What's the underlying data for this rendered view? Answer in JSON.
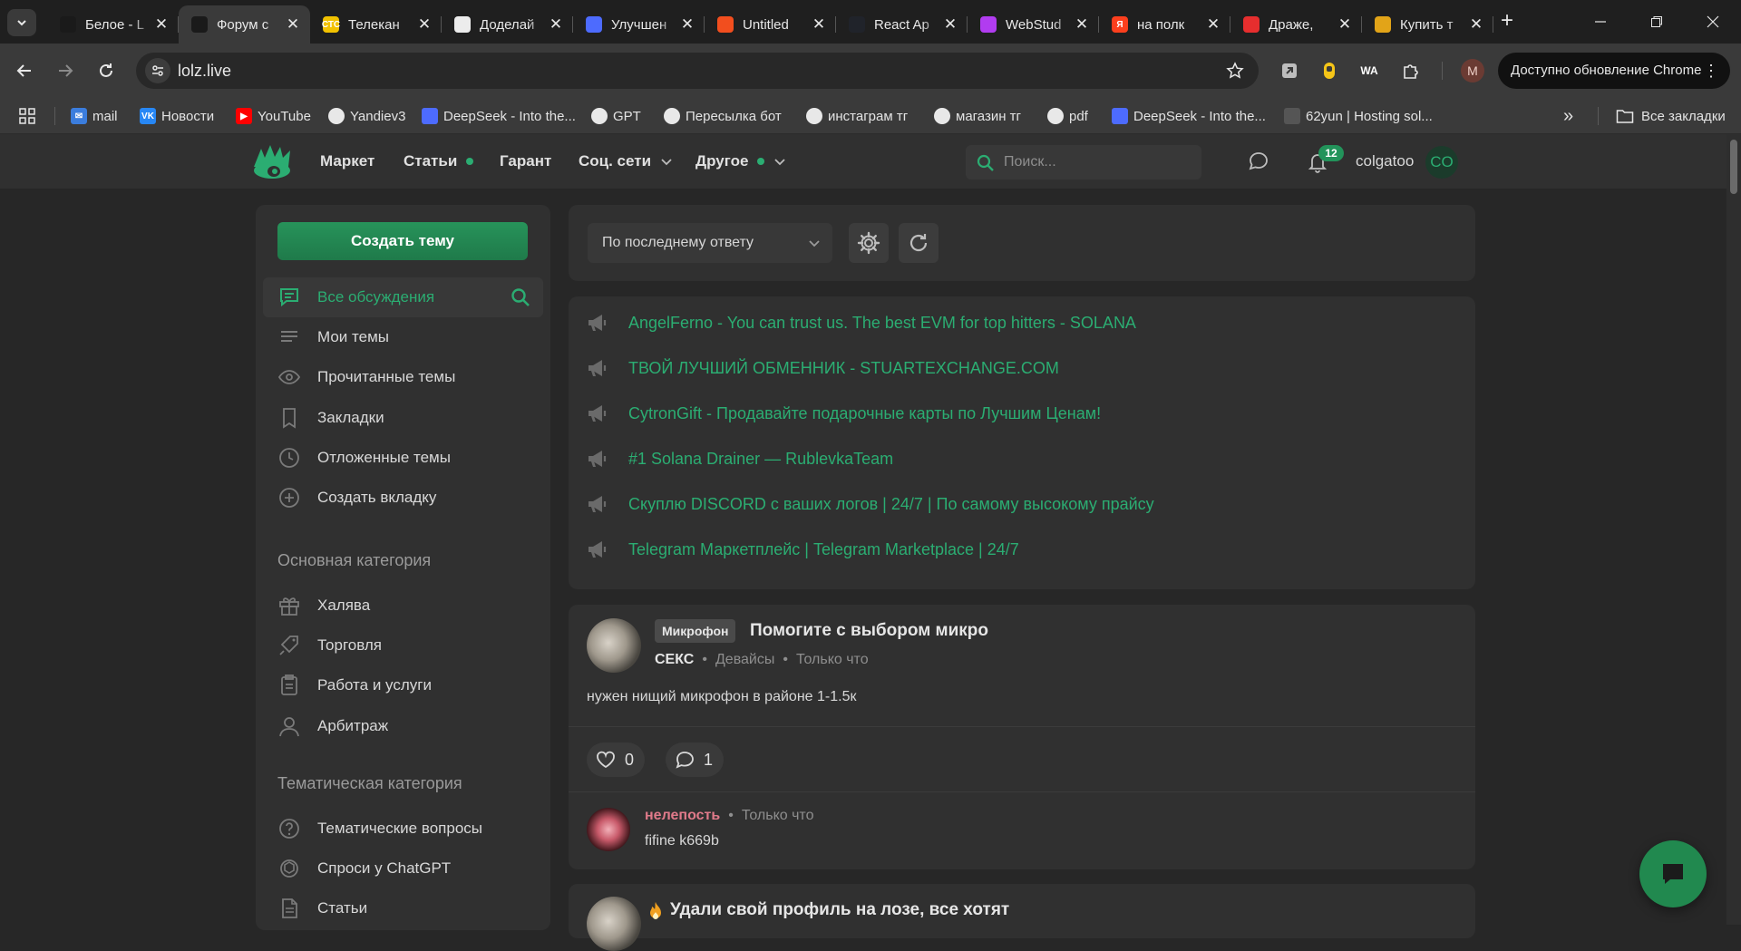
{
  "browser": {
    "tabs": [
      {
        "title": "Белое - L",
        "icon": "lolz-icon",
        "color": "#1a1a1a",
        "glyph": "",
        "active": false
      },
      {
        "title": "Форум с",
        "icon": "lolz-icon",
        "color": "#1a1a1a",
        "glyph": "",
        "active": true
      },
      {
        "title": "Телекан",
        "icon": "ctc-icon",
        "color": "#f2c200",
        "glyph": "СТС",
        "active": false
      },
      {
        "title": "Доделай",
        "icon": "chatgpt-icon",
        "color": "#ececec",
        "glyph": "",
        "active": false
      },
      {
        "title": "Улучшен",
        "icon": "deepseek-icon",
        "color": "#4d6bfe",
        "glyph": "",
        "active": false
      },
      {
        "title": "Untitled",
        "icon": "figma-icon",
        "color": "#f24e1e",
        "glyph": "",
        "active": false
      },
      {
        "title": "React Ap",
        "icon": "react-icon",
        "color": "#20232a",
        "glyph": "",
        "active": false
      },
      {
        "title": "WebStud",
        "icon": "webstudio-icon",
        "color": "#b13cf0",
        "glyph": "",
        "active": false
      },
      {
        "title": "на полк",
        "icon": "yandex-icon",
        "color": "#fc3f1d",
        "glyph": "Я",
        "active": false
      },
      {
        "title": "Драже, ",
        "icon": "ozon-icon",
        "color": "#e62e2e",
        "glyph": "",
        "active": false
      },
      {
        "title": "Купить т",
        "icon": "box-icon",
        "color": "#e2a418",
        "glyph": "",
        "active": false
      }
    ],
    "url": "lolz.live",
    "update_label": "Доступно обновление Chrome",
    "profile_letter": "M",
    "ext_wa_label": "WA",
    "bookmarks": [
      {
        "label": "mail",
        "icon": "mail-icon",
        "color": "#3b7ddd",
        "glyph": "✉"
      },
      {
        "label": "Новости",
        "icon": "vk-icon",
        "color": "#2787f5",
        "glyph": "VK"
      },
      {
        "label": "YouTube",
        "icon": "youtube-icon",
        "color": "#ff0000",
        "glyph": "▶"
      },
      {
        "label": "Yandiev3",
        "icon": "github-icon",
        "color": "#e8e8e8",
        "glyph": ""
      },
      {
        "label": "DeepSeek - Into the...",
        "icon": "deepseek-icon",
        "color": "#4d6bfe",
        "glyph": ""
      },
      {
        "label": "GPT",
        "icon": "chatgpt-icon",
        "color": "#e8e8e8",
        "glyph": ""
      },
      {
        "label": "Пересылка бот",
        "icon": "github-icon",
        "color": "#e8e8e8",
        "glyph": ""
      },
      {
        "label": "инстаграм тг",
        "icon": "github-icon",
        "color": "#e8e8e8",
        "glyph": ""
      },
      {
        "label": "магазин тг",
        "icon": "github-icon",
        "color": "#e8e8e8",
        "glyph": ""
      },
      {
        "label": "pdf",
        "icon": "github-icon",
        "color": "#e8e8e8",
        "glyph": ""
      },
      {
        "label": "DeepSeek - Into the...",
        "icon": "deepseek-icon",
        "color": "#4d6bfe",
        "glyph": ""
      },
      {
        "label": "62yun | Hosting sol...",
        "icon": "hosting-icon",
        "color": "#555555",
        "glyph": ""
      }
    ],
    "all_bookmarks_label": "Все закладки"
  },
  "site": {
    "nav": [
      {
        "label": "Маркет",
        "dot": false,
        "chevron": false
      },
      {
        "label": "Статьи",
        "dot": true,
        "chevron": false
      },
      {
        "label": "Гарант",
        "dot": false,
        "chevron": false
      },
      {
        "label": "Соц. сети",
        "dot": false,
        "chevron": true
      },
      {
        "label": "Другое",
        "dot": true,
        "chevron": true
      }
    ],
    "search_placeholder": "Поиск...",
    "notifications_count": "12",
    "username": "colgatoo",
    "avatar_initials": "CO",
    "accent": "#2bad72"
  },
  "sidebar": {
    "create_label": "Создать тему",
    "items": [
      {
        "label": "Все обсуждения",
        "icon": "discussion-icon",
        "active": true
      },
      {
        "label": "Мои темы",
        "icon": "list-icon",
        "active": false
      },
      {
        "label": "Прочитанные темы",
        "icon": "eye-icon",
        "active": false
      },
      {
        "label": "Закладки",
        "icon": "bookmark-icon",
        "active": false
      },
      {
        "label": "Отложенные темы",
        "icon": "clock-icon",
        "active": false
      },
      {
        "label": "Создать вкладку",
        "icon": "plus-circle-icon",
        "active": false
      }
    ],
    "main_category_title": "Основная категория",
    "main_category": [
      {
        "label": "Халява",
        "icon": "gift-icon"
      },
      {
        "label": "Торговля",
        "icon": "tag-hand-icon"
      },
      {
        "label": "Работа и услуги",
        "icon": "clipboard-icon"
      },
      {
        "label": "Арбитраж",
        "icon": "user-icon"
      }
    ],
    "thematic_category_title": "Тематическая категория",
    "thematic_category": [
      {
        "label": "Тематические вопросы",
        "icon": "question-icon"
      },
      {
        "label": "Спроси у ChatGPT",
        "icon": "chatgpt-icon"
      },
      {
        "label": "Статьи",
        "icon": "document-icon"
      }
    ]
  },
  "feed": {
    "sort_label": "По последнему ответу",
    "announcements": [
      "AngelFerno - You can trust us. The best EVM for top hitters - SOLANA",
      "ТВОЙ ЛУЧШИЙ ОБМЕННИК - STUARTEXCHANGE.COM",
      "CytronGift - Продавайте подарочные карты по Лучшим Ценам!",
      "#1 Solana Drainer — RublevkaTeam",
      "Скуплю DISCORD с ваших логов | 24/7 | По самому высокому прайсу",
      "Telegram Маркетплейс | Telegram Marketplace | 24/7"
    ],
    "post": {
      "tag": "Микрофон",
      "title": "Помогите с выбором микро",
      "author": "СЕКС",
      "section": "Девайсы",
      "time": "Только что",
      "body": "нужен нищий микрофон в районе 1-1.5к",
      "likes": "0",
      "comments": "1",
      "reply": {
        "author": "нелепость",
        "time": "Только что",
        "text": "fifine k669b"
      }
    },
    "next_post_title": "Удали свой профиль на лозе, все хотят"
  }
}
